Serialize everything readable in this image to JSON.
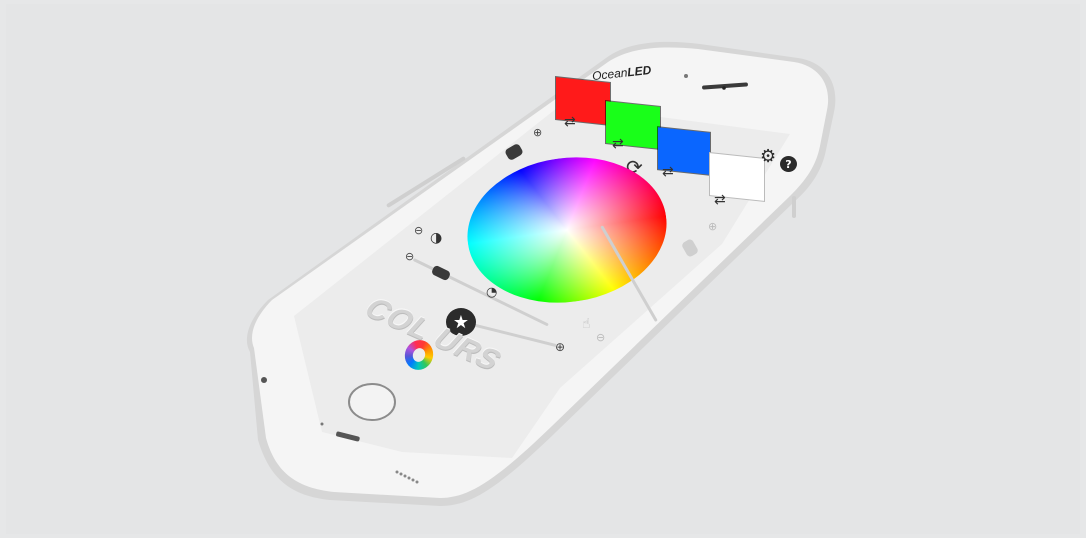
{
  "app": {
    "brand_prefix": "Ocean",
    "brand_suffix": "LED",
    "logo_text": "COL URS"
  },
  "swatches": [
    {
      "color": "#ff1a1a",
      "arrows": "⇄"
    },
    {
      "color": "#19ff19",
      "arrows": "⇄"
    },
    {
      "color": "#0a66ff",
      "arrows": "⇄"
    },
    {
      "color": "#ffffff",
      "arrows": "⇄"
    }
  ],
  "icons": {
    "settings": "gear-icon",
    "help": "question-icon",
    "refresh": "refresh-icon",
    "favourite": "star-icon",
    "brightness": "contrast-icon",
    "speed": "speedometer-icon",
    "touch": "touch-icon",
    "plus": "plus-icon",
    "minus": "minus-icon"
  },
  "sliders": {
    "brightness_level": 0.85,
    "speed_level": 0.2,
    "right_level": 0.7,
    "bottom_level": 0.5
  },
  "colors": {
    "phone_body": "#f4f4f4",
    "phone_edge": "#c9c9c9",
    "screen_bg": "#ececec",
    "button_dark": "#2b2b2b"
  }
}
